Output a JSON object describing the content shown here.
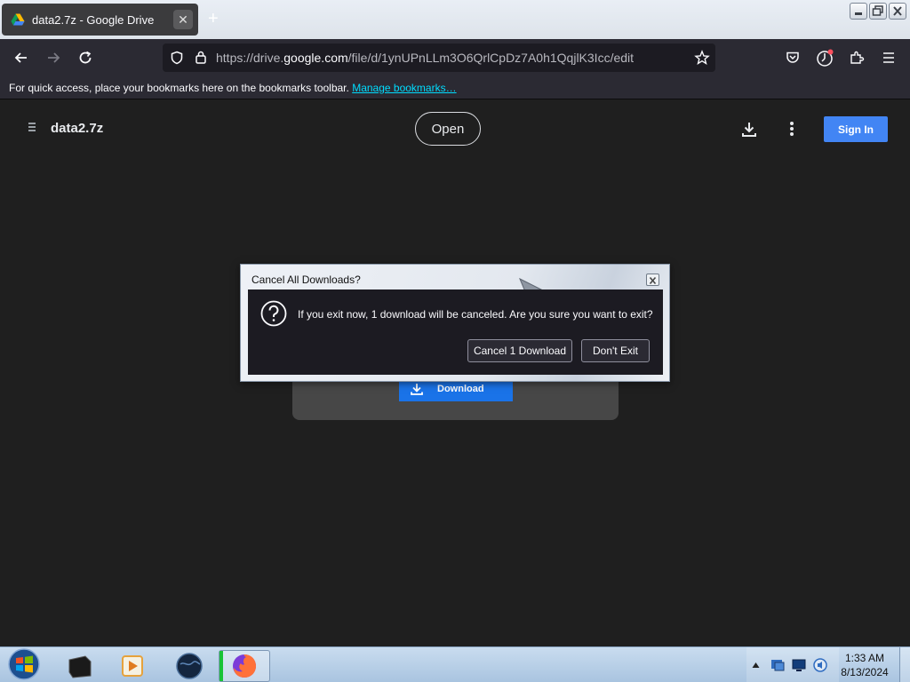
{
  "browser": {
    "tab": {
      "title": "data2.7z - Google Drive"
    },
    "url": {
      "prefix": "https://drive.",
      "host": "google.com",
      "path": "/file/d/1ynUPnLLm3O6QrlCpDz7A0h1QqjlK3Icc/edit"
    },
    "bookmarks_bar": {
      "text": "For quick access, place your bookmarks here on the bookmarks toolbar.",
      "link": "Manage bookmarks…"
    }
  },
  "drive": {
    "filename": "data2.7z",
    "open_label": "Open",
    "signin_label": "Sign In",
    "download_label": "Download"
  },
  "dialog": {
    "title": "Cancel All Downloads?",
    "message": "If you exit now, 1 download will be canceled. Are you sure you want to exit?",
    "cancel_download_label": "Cancel 1 Download",
    "dont_exit_label": "Don't Exit"
  },
  "taskbar": {
    "time": "1:33 AM",
    "date": "8/13/2024"
  },
  "colors": {
    "accent": "#4285f4",
    "download_blue": "#1a73e8",
    "link": "#00ddff"
  }
}
